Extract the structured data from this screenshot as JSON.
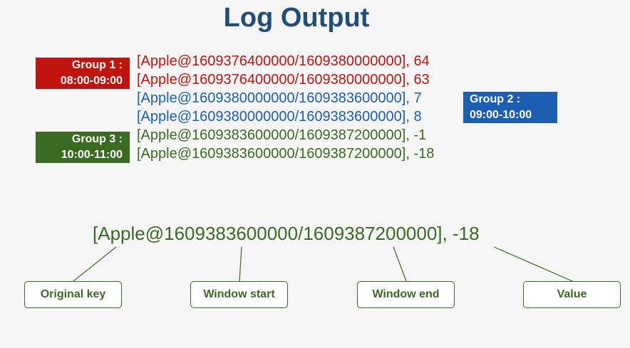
{
  "title": "Log Output",
  "groups": [
    {
      "label": "Group 1 :",
      "time": "08:00-09:00",
      "color": "#c0140e"
    },
    {
      "label": "Group 2 :",
      "time": "09:00-10:00",
      "color": "#1c5fb2"
    },
    {
      "label": "Group 3 :",
      "time": "10:00-11:00",
      "color": "#3b6b23"
    }
  ],
  "log_lines": [
    "[Apple@1609376400000/1609380000000], 64",
    "[Apple@1609376400000/1609380000000], 63",
    "[Apple@1609380000000/1609383600000], 7",
    "[Apple@1609380000000/1609383600000], 8",
    "[Apple@1609383600000/1609387200000], -1",
    "[Apple@1609383600000/1609387200000], -18"
  ],
  "example_line": "[Apple@1609383600000/1609387200000], -18",
  "callouts": {
    "original_key": "Original key",
    "window_start": "Window start",
    "window_end": "Window end",
    "value": "Value"
  }
}
